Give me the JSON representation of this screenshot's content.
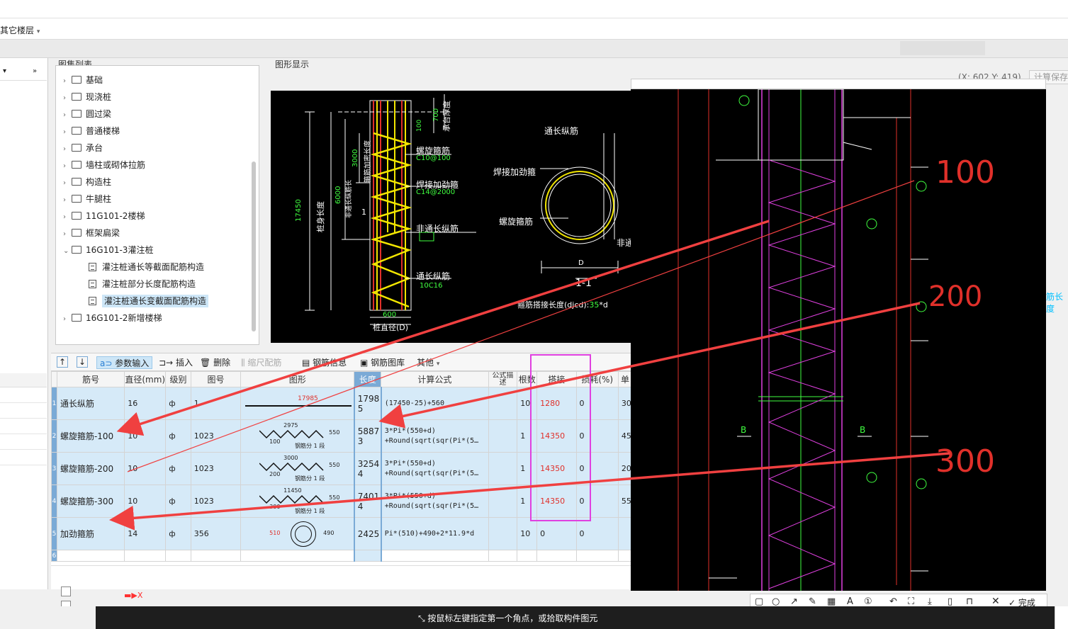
{
  "floor": {
    "label": "其它楼层",
    "dropdown": "▾"
  },
  "coordinates": "(X: 602 Y: 419)",
  "save_button": "计算保存",
  "atlas": {
    "title": "图集列表",
    "items": [
      {
        "label": "基础",
        "type": "folder"
      },
      {
        "label": "现浇桩",
        "type": "folder"
      },
      {
        "label": "圆过梁",
        "type": "folder"
      },
      {
        "label": "普通楼梯",
        "type": "folder"
      },
      {
        "label": "承台",
        "type": "folder"
      },
      {
        "label": "墙柱或砌体拉筋",
        "type": "folder"
      },
      {
        "label": "构造柱",
        "type": "folder"
      },
      {
        "label": "牛腿柱",
        "type": "folder"
      },
      {
        "label": "11G101-2楼梯",
        "type": "folder"
      },
      {
        "label": "框架扁梁",
        "type": "folder"
      },
      {
        "label": "16G101-3灌注桩",
        "type": "folder-open"
      },
      {
        "label": "灌注桩通长等截面配筋构造",
        "type": "doc"
      },
      {
        "label": "灌注桩部分长度配筋构造",
        "type": "doc"
      },
      {
        "label": "灌注桩通长变截面配筋构造",
        "type": "doc",
        "selected": true
      },
      {
        "label": "16G101-2新增楼梯",
        "type": "folder"
      }
    ]
  },
  "figure": {
    "title": "图形显示",
    "labels": {
      "spiral": "螺旋箍筋",
      "spiral_spec": "C10@100",
      "weld": "焊接加劲箍",
      "weld_spec": "C14@2000",
      "non_through": "非通长纵筋",
      "through": "通长纵筋",
      "through_spec": "10C16",
      "pile_len": "桩身长度",
      "len_17450": "17450",
      "len_6000": "6000",
      "len_3000": "3000",
      "len_700": "700",
      "len_100": "100",
      "len_600": "600",
      "non_through_len": "非通长纵筋长",
      "dense_len": "箍筋加密长度",
      "cap_embed": "承台厚度",
      "pile_dia": "桩直径(D)",
      "section_through": "通长纵筋",
      "section_weld": "焊接加劲箍",
      "section_spiral": "螺旋箍筋",
      "section_non": "非通",
      "section_d": "D",
      "section_name": "1-1",
      "lap_formula_prefix": "箍筋搭接长度(djcd):",
      "lap_formula_value": "35",
      "lap_formula_suffix": "*d",
      "mark_1": "1"
    }
  },
  "toolbar": {
    "up": "↑",
    "down": "↓",
    "param_input": "参数输入",
    "insert": "插入",
    "delete": "删除",
    "scale": "缩尺配筋",
    "rebar_info": "钢筋信息",
    "rebar_lib": "钢筋图库",
    "other": "其他"
  },
  "table": {
    "headers": [
      "筋号",
      "直径(mm)",
      "级别",
      "图号",
      "图形",
      "长度",
      "计算公式",
      "公式描述",
      "根数",
      "搭接",
      "损耗(%)",
      "单"
    ],
    "rows": [
      {
        "idx": "1",
        "name": "通长纵筋",
        "dia": "16",
        "grade": "ф",
        "fig": "1",
        "shape_dim": "17985",
        "len1": "1798",
        "len2": "5",
        "formula1": "(17450-25)+560",
        "formula2": "",
        "count": "10",
        "lap": "1280",
        "loss": "0",
        "unit": "30"
      },
      {
        "idx": "2",
        "name": "螺旋箍筋-100",
        "dia": "10",
        "grade": "ф",
        "fig": "1023",
        "shape_dim": "2975",
        "shape_sub": "100",
        "shape_note": "钢筋分 1 段",
        "shape_side": "550",
        "len1": "5887",
        "len2": "3",
        "formula1": "3*Pi*(550+d)",
        "formula2": "+Round(sqrt(sqr(Pi*(5…",
        "count": "1",
        "lap": "14350",
        "loss": "0",
        "unit": "45"
      },
      {
        "idx": "3",
        "name": "螺旋箍筋-200",
        "dia": "10",
        "grade": "ф",
        "fig": "1023",
        "shape_dim": "3000",
        "shape_sub": "200",
        "shape_note": "钢筋分 1 段",
        "shape_side": "550",
        "len1": "3254",
        "len2": "4",
        "formula1": "3*Pi*(550+d)",
        "formula2": "+Round(sqrt(sqr(Pi*(5…",
        "count": "1",
        "lap": "14350",
        "loss": "0",
        "unit": "20"
      },
      {
        "idx": "4",
        "name": "螺旋箍筋-300",
        "dia": "10",
        "grade": "ф",
        "fig": "1023",
        "shape_dim": "11450",
        "shape_sub": "300",
        "shape_note": "钢筋分 1 段",
        "shape_side": "550",
        "len1": "7401",
        "len2": "4",
        "formula1": "3*Pi*(550+d)",
        "formula2": "+Round(sqrt(sqr(Pi*(5…",
        "count": "1",
        "lap": "14350",
        "loss": "0",
        "unit": "55"
      },
      {
        "idx": "5",
        "name": "加劲箍筋",
        "dia": "14",
        "grade": "ф",
        "fig": "356",
        "shape_dim": "510",
        "shape_side": "490",
        "len1": "2425",
        "len2": "",
        "formula1": "Pi*(510)+490+2*11.9*d",
        "formula2": "",
        "count": "10",
        "lap": "0",
        "loss": "0",
        "unit": ""
      },
      {
        "idx": "6",
        "name": "",
        "dia": "",
        "grade": "",
        "fig": "",
        "shape_dim": "",
        "len1": "",
        "len2": "",
        "formula1": "",
        "formula2": "",
        "count": "",
        "lap": "",
        "loss": "",
        "unit": ""
      }
    ]
  },
  "cad": {
    "handwritten": [
      "100",
      "200",
      "300"
    ],
    "marks": [
      "B",
      "B"
    ],
    "side_text": "筋长度"
  },
  "annotation_bar": {
    "done": "完成"
  },
  "status": "按鼠标左键指定第一个角点，或拾取构件图元",
  "colors": {
    "accent": "#cde6f7",
    "highlight": "#e0302a",
    "cad_yellow": "#f2e600",
    "cad_magenta": "#e040e0"
  }
}
